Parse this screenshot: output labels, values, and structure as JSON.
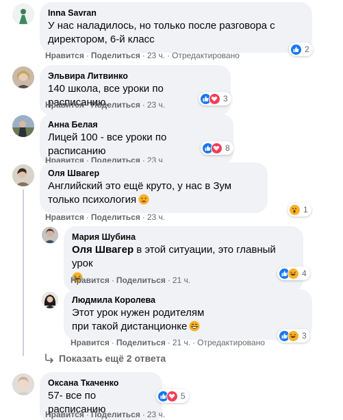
{
  "actions": {
    "like": "Нравится",
    "reply": "Поделиться",
    "dot": "·"
  },
  "colors": {
    "like": "#1877f2",
    "love": "#f33e58",
    "wow": "#f7b125",
    "meta": "#65676b",
    "bubble": "#f0f2f5"
  },
  "comments": [
    {
      "author": "Inna Savran",
      "text": "У нас наладилось, но только после разговора с директором, 6-й класс",
      "time": "23 ч.",
      "edited": "Отредактировано",
      "reactions": [
        "like"
      ],
      "reaction_count": "2"
    },
    {
      "author": "Эльвира Литвинко",
      "text": "140 школа, все уроки по расписанию.",
      "time": "23 ч.",
      "reactions": [
        "like",
        "love"
      ],
      "reaction_count": "3"
    },
    {
      "author": "Анна Белая",
      "text": "Лицей 100 - все уроки по расписанию",
      "time": "23 ч.",
      "reactions": [
        "like",
        "love"
      ],
      "reaction_count": "8"
    },
    {
      "author": "Оля Швагер",
      "text": "Английский это ещё круто, у нас в Зум только психология",
      "emoji": "sad-face-emoji",
      "time": "23 ч.",
      "reactions": [
        "wow"
      ],
      "reaction_count": "1"
    },
    {
      "author": "Оксана Ткаченко",
      "text": "57- все по расписанию",
      "time": "23 ч.",
      "reactions": [
        "like",
        "love"
      ],
      "reaction_count": "5"
    }
  ],
  "replies": [
    {
      "author": "Мария Шубина",
      "mention": "Оля Швагер",
      "text": " в этой ситуации, это главный урок",
      "emoji": "laughing-emoji",
      "time": "21 ч.",
      "reactions": [
        "like",
        "haha"
      ],
      "reaction_count": "4"
    },
    {
      "author": "Людмила Королева",
      "text": "Этот урок нужен родителям при такой дистанционке",
      "emoji": "grinning-emoji",
      "time": "21 ч.",
      "edited": "Отредактировано",
      "reactions": [
        "like",
        "haha"
      ],
      "reaction_count": "3"
    }
  ],
  "show_more": "Показать ещё 2 ответа"
}
